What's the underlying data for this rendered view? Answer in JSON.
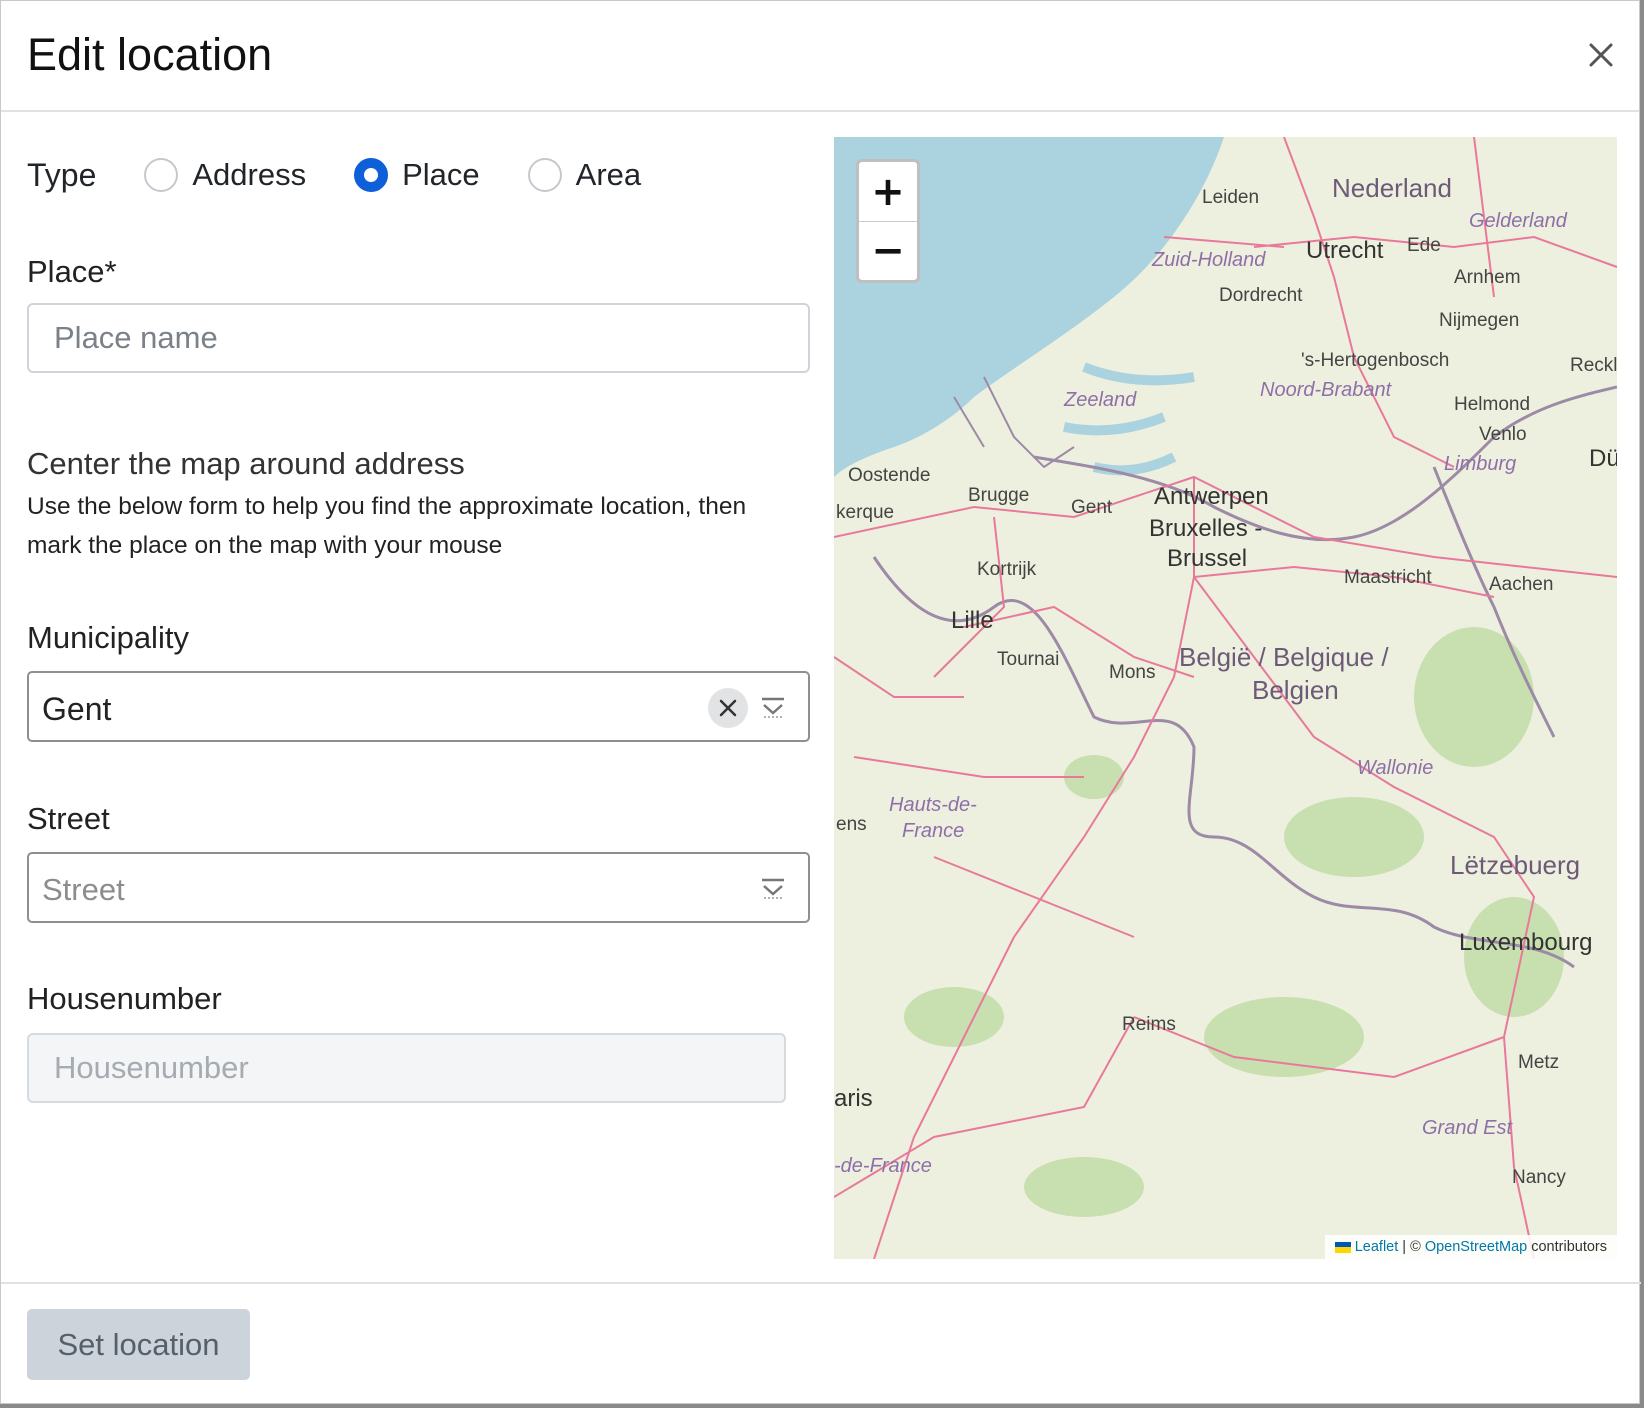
{
  "modal": {
    "title": "Edit location"
  },
  "type_selector": {
    "label": "Type",
    "options": [
      {
        "label": "Address",
        "checked": false
      },
      {
        "label": "Place",
        "checked": true
      },
      {
        "label": "Area",
        "checked": false
      }
    ]
  },
  "place": {
    "label": "Place*",
    "placeholder": "Place name",
    "value": ""
  },
  "center_section": {
    "title": "Center the map around address",
    "help_line1": "Use the below form to help you find the approximate location, then",
    "help_line2": "mark the place on the map with your mouse"
  },
  "municipality": {
    "label": "Municipality",
    "value": "Gent"
  },
  "street": {
    "label": "Street",
    "placeholder": "Street"
  },
  "housenumber": {
    "label": "Housenumber",
    "placeholder": "Housenumber"
  },
  "map": {
    "zoom_in": "+",
    "zoom_out": "−",
    "labels": {
      "nederland": "Nederland",
      "gelderland": "Gelderland",
      "leiden": "Leiden",
      "zuid_holland": "Zuid-Holland",
      "utrecht": "Utrecht",
      "ede": "Ede",
      "arnhem": "Arnhem",
      "dordrecht": "Dordrecht",
      "nijmegen": "Nijmegen",
      "hertogenbosch": "'s-Hertogenbosch",
      "reckl": "Reckl",
      "zeeland": "Zeeland",
      "noord_brabant": "Noord-Brabant",
      "helmond": "Helmond",
      "venlo": "Venlo",
      "limburg": "Limburg",
      "du": "Dü",
      "oostende": "Oostende",
      "brugge": "Brugge",
      "gent": "Gent",
      "antwerpen": "Antwerpen",
      "kerque": "kerque",
      "bruxelles1": "Bruxelles -",
      "bruxelles2": "Brussel",
      "kortrijk": "Kortrijk",
      "maastricht": "Maastricht",
      "aachen": "Aachen",
      "lille": "Lille",
      "tournai": "Tournai",
      "mons": "Mons",
      "belgie1": "België / Belgique /",
      "belgie2": "Belgien",
      "wallonie": "Wallonie",
      "hauts1": "Hauts-de-",
      "hauts2": "France",
      "ens": "ens",
      "letzebuerg": "Lëtzebuerg",
      "luxembourg": "Luxembourg",
      "reims": "Reims",
      "metz": "Metz",
      "aris": "aris",
      "grand_est": "Grand Est",
      "de_france": "-de-France",
      "nancy": "Nancy"
    },
    "attribution": {
      "leaflet": "Leaflet",
      "sep": " | © ",
      "osm": "OpenStreetMap",
      "contributors": " contributors"
    }
  },
  "footer": {
    "set_location": "Set location"
  },
  "colors": {
    "accent": "#0d60d8",
    "sea": "#aad3df",
    "land": "#eef0df",
    "road": "#e8799a",
    "border": "#9c8aa6",
    "forest": "#c8dfb0"
  }
}
